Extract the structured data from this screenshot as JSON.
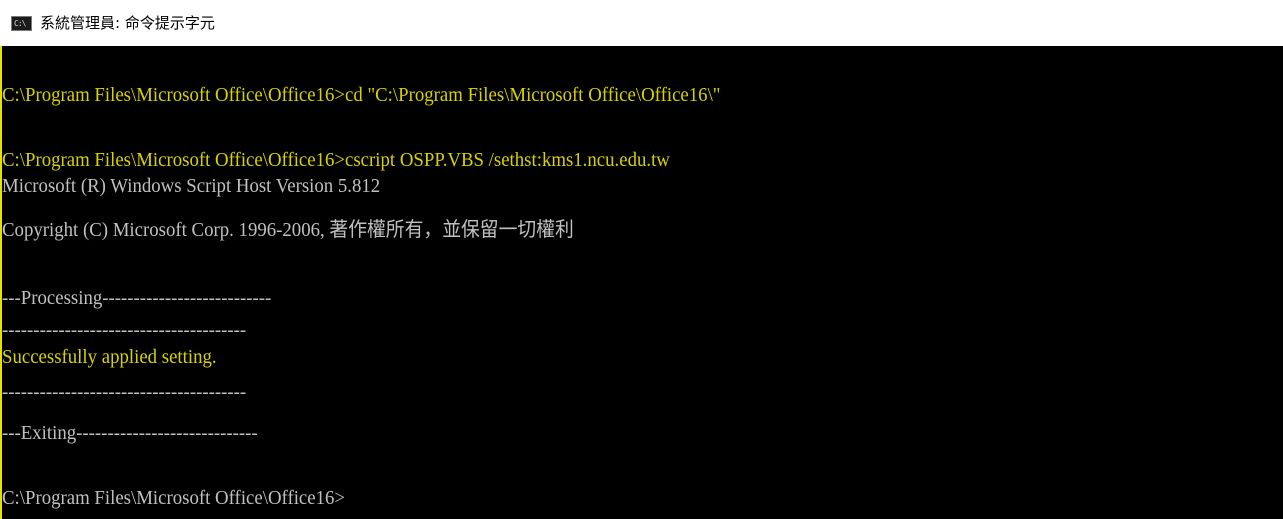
{
  "window": {
    "title": "系統管理員: 命令提示字元",
    "icon": "cmd-icon",
    "icon_text": "C:\\"
  },
  "console": {
    "lines": [
      "C:\\Program Files\\Microsoft Office\\Office16>cd \"C:\\Program Files\\Microsoft Office\\Office16\\\"",
      "C:\\Program Files\\Microsoft Office\\Office16>cscript OSPP.VBS /sethst:kms1.ncu.edu.tw",
      "Microsoft (R) Windows Script Host Version 5.812",
      "Copyright (C) Microsoft Corp. 1996-2006, 著作權所有，並保留一切權利",
      "---Processing---------------------------",
      "---------------------------------------",
      "Successfully applied setting.",
      "---------------------------------------",
      "---Exiting-----------------------------",
      "C:\\Program Files\\Microsoft Office\\Office16>"
    ],
    "highlight_color": "#d7d200",
    "text_color": "#c0c0c0",
    "background_color": "#000000"
  }
}
